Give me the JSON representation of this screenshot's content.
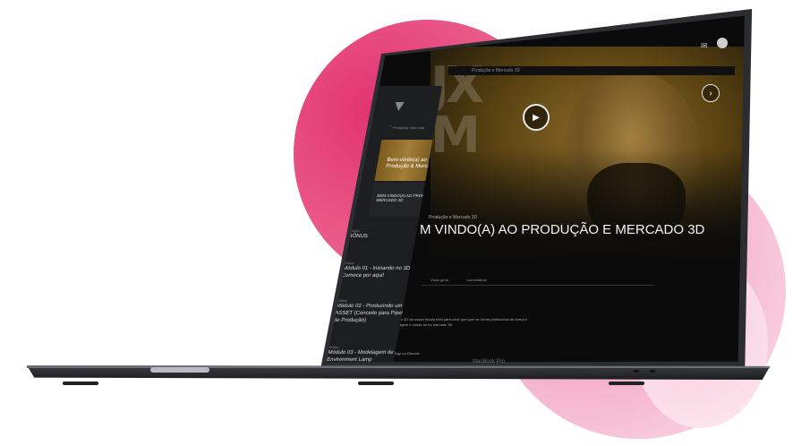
{
  "video": {
    "breadcrumb": "Produção e Mercado 3D",
    "course_label": "Produção e Mercado 3D",
    "lesson_title": "M VINDO(A) AO PRODUÇÃO E MERCADO 3D",
    "overlay_letters": "JX\nM",
    "play_icon": "play-icon",
    "next_icon": "chevron-right-icon"
  },
  "header": {
    "chat_icon": "chat-bubble-icon",
    "avatar": "user-avatar"
  },
  "tabs": [
    {
      "label": "Visão geral"
    },
    {
      "label": "Comentários"
    }
  ],
  "description": {
    "line_1": "Curso Produção e Mercado 3D da nossa escola feito para você que quer se tornar profissional de forma e",
    "line_2": "do seu modo de aprendizagem e inserir-se no mercado 3D",
    "line_3": "nosso grupo do WhatsApp ou Discord"
  },
  "sidebar": {
    "close_label": "×",
    "search_placeholder": "Pesquisar uma aula",
    "current_lesson": "Bem-vindo(a) ao Produção & Mercado 3D",
    "section_title": "BEM-VINDO(A) AO PRODUÇÃO E MERCADO 3D",
    "items": [
      {
        "module": "Módulo",
        "name": "BÔNUS",
        "count": "3"
      },
      {
        "module": "Módulo",
        "name": "Módulo 01 - Iniciando no 3D! Comece por aqui!",
        "count": "4"
      },
      {
        "module": "Módulo",
        "name": "Módulo 02 - Produzindo um ASSET (Conceito para Pipeline de Produção)",
        "count": "10"
      },
      {
        "module": "Módulo",
        "name": "Módulo 03 - Modelagem de um Environment Lamp",
        "count": "8"
      }
    ]
  },
  "laptop": {
    "brand_label": "MacBook Pro"
  }
}
